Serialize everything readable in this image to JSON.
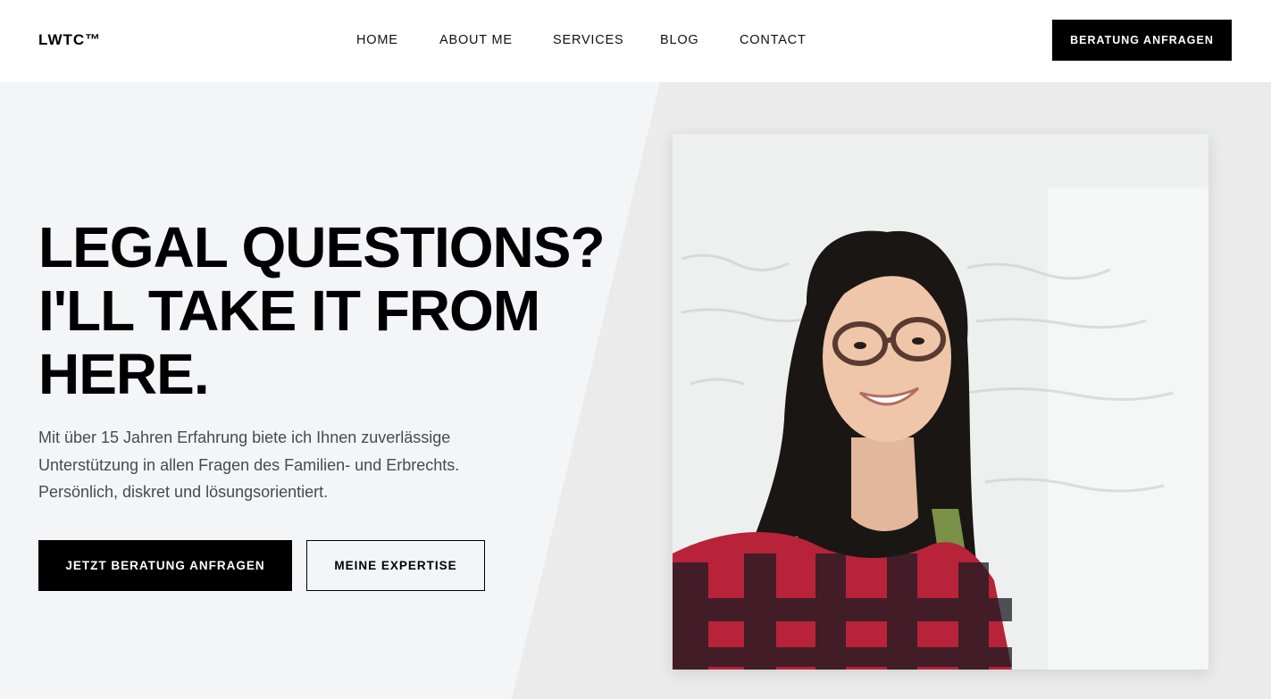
{
  "brand": {
    "logo": "LWTC™"
  },
  "nav": {
    "items": [
      {
        "label": "HOME"
      },
      {
        "label": "ABOUT ME"
      },
      {
        "label": "SERVICES"
      },
      {
        "label": "BLOG"
      },
      {
        "label": "CONTACT"
      }
    ]
  },
  "header": {
    "cta_label": "BERATUNG ANFRAGEN"
  },
  "hero": {
    "title": "LEGAL QUESTIONS? I'LL TAKE IT FROM HERE.",
    "description": "Mit über 15 Jahren Erfahrung biete ich Ihnen zuverlässige Unterstützung in allen Fragen des Familien- und Erbrechts. Persönlich, diskret und lösungsorientiert.",
    "primary_button": "JETZT BERATUNG ANFRAGEN",
    "secondary_button": "MEINE EXPERTISE"
  },
  "colors": {
    "primary": "#000000",
    "hero_bg_left": "#f4f5f7",
    "hero_bg_right": "#ebebeb",
    "text_muted": "#4a4a4a"
  }
}
